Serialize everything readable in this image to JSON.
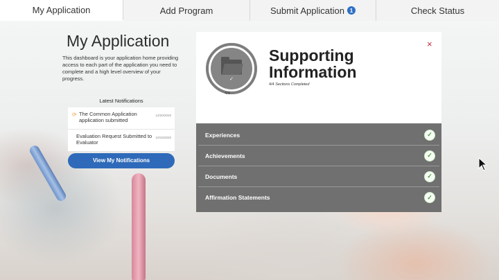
{
  "nav": {
    "tabs": [
      {
        "label": "My Application"
      },
      {
        "label": "Add Program"
      },
      {
        "label": "Submit Application",
        "badge": "1"
      },
      {
        "label": "Check Status"
      }
    ]
  },
  "left": {
    "title": "My Application",
    "intro": "This dashboard is your application home providing access to each part of the application you need to complete and a high level overview of your progress.",
    "notifications_heading": "Latest Notifications",
    "notifications": [
      {
        "text": "The Common Application application submitted",
        "date": "12/20/2020"
      },
      {
        "text": "Evaluation Request Submitted to Evaluator",
        "date": "10/16/2020"
      }
    ],
    "view_button": "View My Notifications"
  },
  "card": {
    "ring_count": "4/4",
    "title": "Supporting Information",
    "completed_count": "4/4",
    "completed_label": "Sections Completed",
    "close_symbol": "×",
    "items": [
      {
        "label": "Experiences"
      },
      {
        "label": "Achievements"
      },
      {
        "label": "Documents"
      },
      {
        "label": "Affirmation Statements"
      }
    ]
  },
  "colors": {
    "accent_blue": "#2e6ab9",
    "check_green": "#4c9a3f",
    "close_red": "#c0263a",
    "panel_gray": "#707070"
  },
  "icons": {
    "folder": "folder-icon",
    "check": "check-icon",
    "close": "close-icon"
  }
}
